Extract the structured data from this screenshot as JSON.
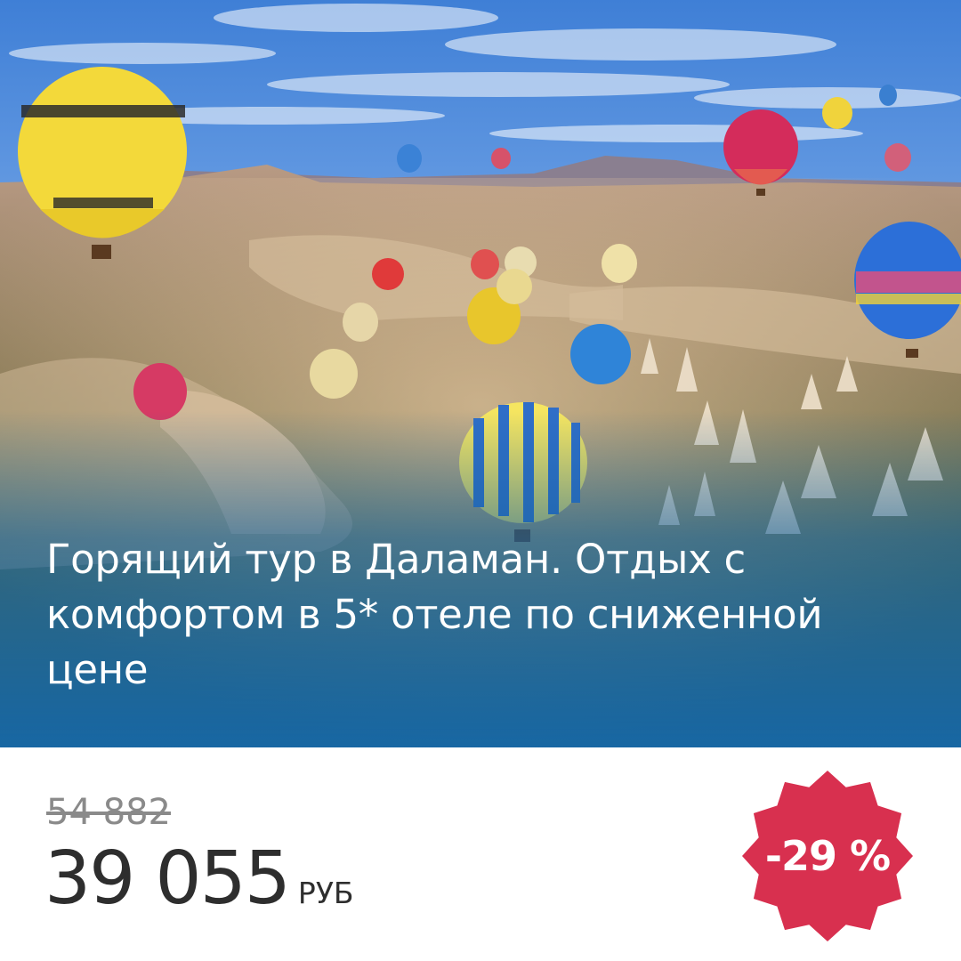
{
  "ad": {
    "headline": "Горящий тур в Даламан. Отдых с комфортом в 5* отеле по сниженной цене",
    "hero_image": "hot-air-balloons-over-valley-photo"
  },
  "price": {
    "old": "54 882",
    "current": "39 055",
    "currency": "РУБ"
  },
  "discount": {
    "label": "-29 %",
    "badge_color": "#d8304f"
  },
  "colors": {
    "overlay_blue": "#1868a8",
    "price_text": "#2e2e2e",
    "old_price_text": "#8a8a8a"
  }
}
